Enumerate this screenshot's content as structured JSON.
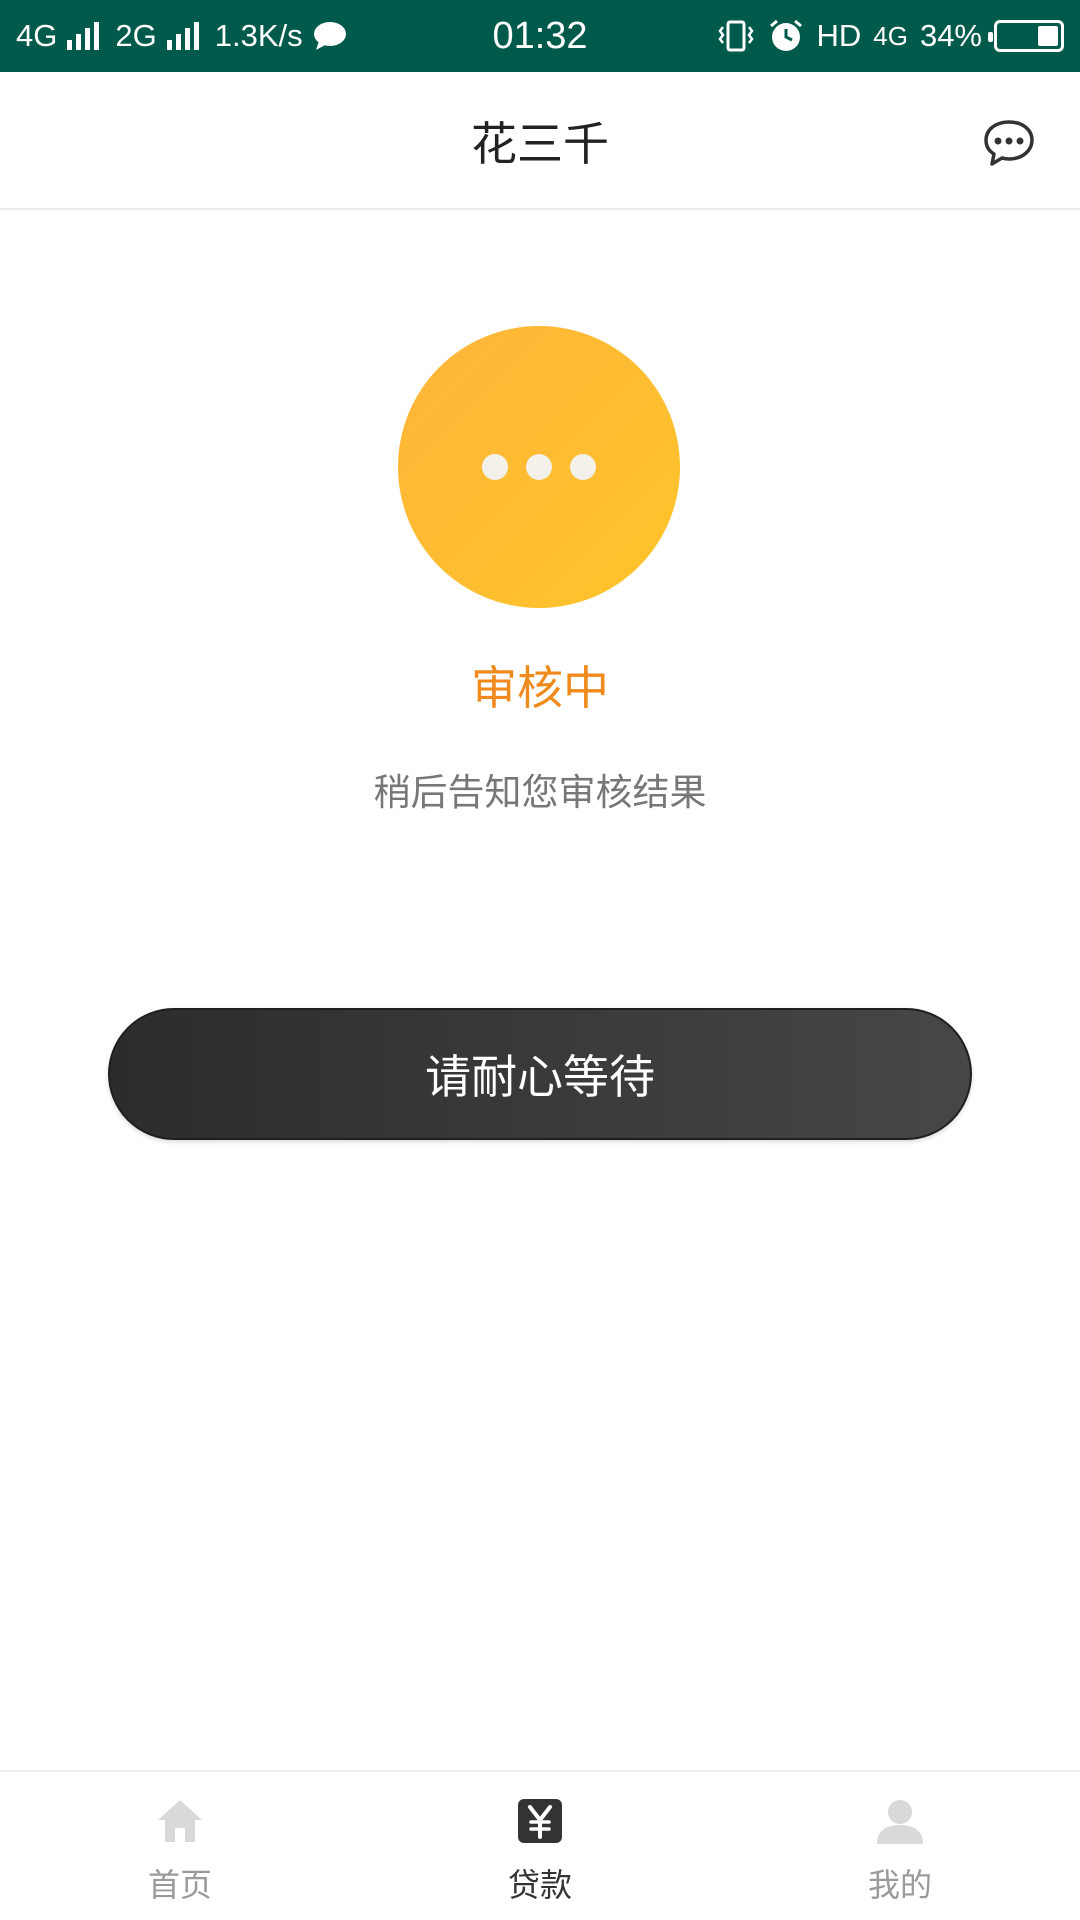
{
  "status_bar": {
    "net1": "4G",
    "net2": "2G",
    "speed": "1.3K/s",
    "time": "01:32",
    "hd": "HD",
    "net3": "4G",
    "battery_text": "34%",
    "battery_level": 0.34
  },
  "header": {
    "title": "花三千"
  },
  "status": {
    "title": "审核中",
    "description": "稍后告知您审核结果"
  },
  "action": {
    "wait_label": "请耐心等待"
  },
  "bottom_nav": {
    "items": [
      {
        "label": "首页",
        "icon": "home-icon"
      },
      {
        "label": "贷款",
        "icon": "yuan-icon"
      },
      {
        "label": "我的",
        "icon": "user-icon"
      }
    ],
    "active_index": 1
  },
  "colors": {
    "status_bar_bg": "#005a4c",
    "accent_orange": "#f08a1c",
    "circle_yellow": "#ffc02f",
    "button_dark": "#333333"
  }
}
